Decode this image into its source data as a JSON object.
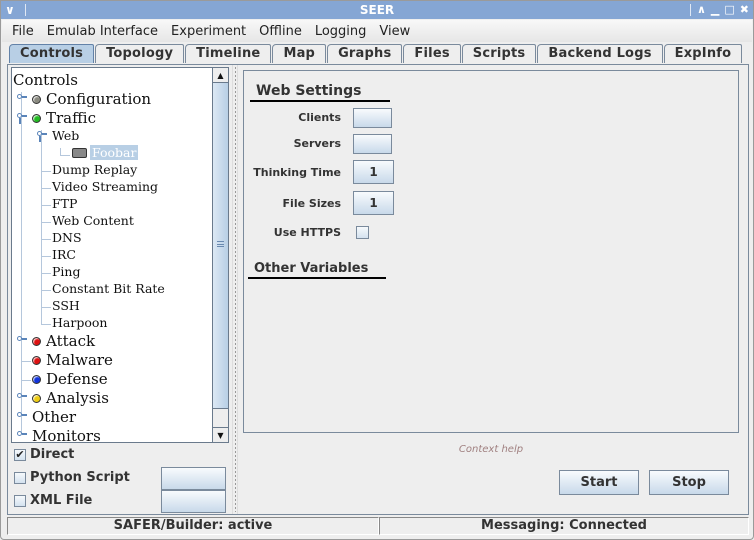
{
  "window": {
    "title": "SEER",
    "controls": [
      "restore",
      "minimize",
      "maximize",
      "close"
    ]
  },
  "menubar": [
    "File",
    "Emulab Interface",
    "Experiment",
    "Offline",
    "Logging",
    "View"
  ],
  "tabs": [
    {
      "label": "Controls",
      "active": true
    },
    {
      "label": "Topology",
      "active": false
    },
    {
      "label": "Timeline",
      "active": false
    },
    {
      "label": "Map",
      "active": false
    },
    {
      "label": "Graphs",
      "active": false
    },
    {
      "label": "Files",
      "active": false
    },
    {
      "label": "Scripts",
      "active": false
    },
    {
      "label": "Backend Logs",
      "active": false
    },
    {
      "label": "ExpInfo",
      "active": false
    }
  ],
  "tree": {
    "root": "Controls",
    "items": {
      "configuration": {
        "label": "Configuration",
        "status_color": "#8a8a80"
      },
      "traffic": {
        "label": "Traffic",
        "status_color": "#22bb22"
      },
      "web": {
        "label": "Web"
      },
      "foobar": {
        "label": "Foobar",
        "selected": true
      },
      "dump_replay": {
        "label": "Dump Replay"
      },
      "video_streaming": {
        "label": "Video Streaming"
      },
      "ftp": {
        "label": "FTP"
      },
      "web_content": {
        "label": "Web Content"
      },
      "dns": {
        "label": "DNS"
      },
      "irc": {
        "label": "IRC"
      },
      "ping": {
        "label": "Ping"
      },
      "constant_bit_rate": {
        "label": "Constant Bit Rate"
      },
      "ssh": {
        "label": "SSH"
      },
      "harpoon": {
        "label": "Harpoon"
      },
      "attack": {
        "label": "Attack",
        "status_color": "#dd1111"
      },
      "malware": {
        "label": "Malware",
        "status_color": "#dd1111"
      },
      "defense": {
        "label": "Defense",
        "status_color": "#1133dd"
      },
      "analysis": {
        "label": "Analysis",
        "status_color": "#eecc11"
      },
      "other": {
        "label": "Other"
      },
      "monitors": {
        "label": "Monitors"
      }
    }
  },
  "options": {
    "direct": {
      "label": "Direct",
      "checked": true
    },
    "python_script": {
      "label": "Python Script",
      "checked": false
    },
    "xml_file": {
      "label": "XML File",
      "checked": false
    }
  },
  "settings": {
    "web_settings_title": "Web Settings",
    "clients": {
      "label": "Clients",
      "value": ""
    },
    "servers": {
      "label": "Servers",
      "value": ""
    },
    "thinking_time": {
      "label": "Thinking Time",
      "value": "1"
    },
    "file_sizes": {
      "label": "File Sizes",
      "value": "1"
    },
    "use_https": {
      "label": "Use HTTPS",
      "checked": false
    },
    "other_variables_title": "Other Variables"
  },
  "context_help": "Context help",
  "buttons": {
    "start": "Start",
    "stop": "Stop"
  },
  "status": {
    "left": "SAFER/Builder: active",
    "right": "Messaging: Connected"
  },
  "icons": {
    "window_menu": "∨",
    "restore": "∧",
    "minimize": "▁",
    "maximize": "□",
    "close": "✖",
    "check": "✔",
    "scroll_up": "▲",
    "scroll_down": "▼"
  }
}
